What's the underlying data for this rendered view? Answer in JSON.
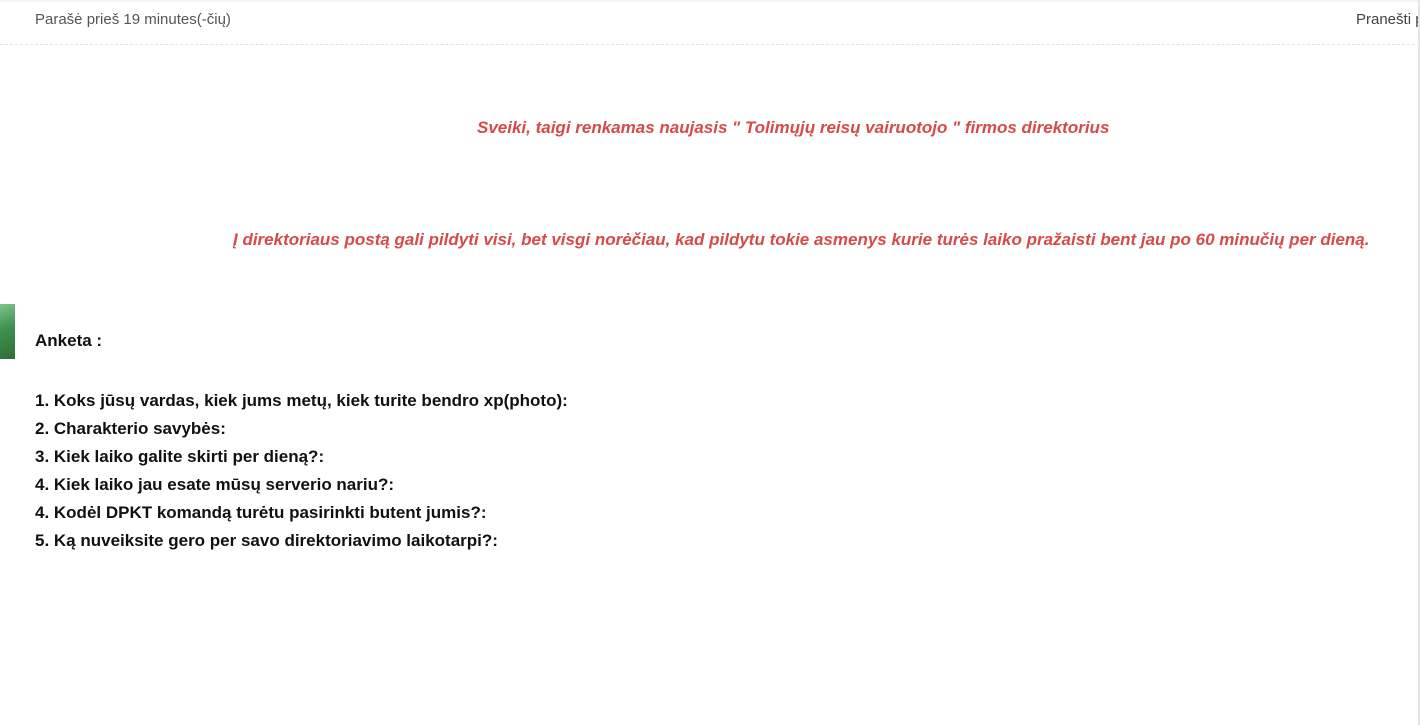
{
  "post": {
    "meta": "Parašė prieš 19 minutes(-čių)",
    "report_label": "Pranešti p"
  },
  "announcement": {
    "line1": "Sveiki, taigi renkamas naujasis \" Tolimųjų reisų vairuotojo \" firmos direktorius",
    "line2": "Į direktoriaus postą gali pildyti visi, bet visgi norėčiau, kad pildytu tokie asmenys kurie turės laiko pražaisti bent jau po 60 minučių per dieną."
  },
  "form": {
    "title": "Anketa :",
    "questions": [
      "1. Koks jūsų vardas, kiek jums metų, kiek turite bendro xp(photo):",
      "2. Charakterio savybės:",
      "3. Kiek laiko galite skirti per dieną?:",
      "4. Kiek laiko jau esate mūsų serverio nariu?:",
      "4. Kodėl DPKT komandą turėtu pasirinkti butent jumis?:",
      "5. Ką nuveiksite gero per savo direktoriavimo laikotarpi?:"
    ]
  },
  "colors": {
    "announcement_text": "#d64a4a",
    "body_text": "#111111",
    "meta_text": "#555555"
  }
}
